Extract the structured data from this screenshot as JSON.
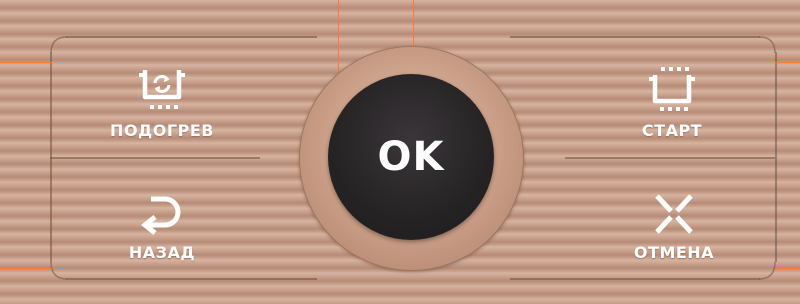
{
  "panel": {
    "colors": {
      "base": "#c79f8a",
      "stripe_light": "#d6b4a1",
      "stripe_dark": "#b58c77",
      "ring": "#c99d85",
      "ok_button": "#262325",
      "callout_line": "#ff7a2a",
      "label_text": "#ffffff"
    },
    "buttons": {
      "reheat": {
        "label": "ПОДОГРЕВ",
        "icon": "pot-refresh-icon"
      },
      "start": {
        "label": "СТАРТ",
        "icon": "pot-steam-icon"
      },
      "back": {
        "label": "НАЗАД",
        "icon": "back-arrow-icon"
      },
      "cancel": {
        "label": "ОТМЕНА",
        "icon": "close-icon"
      },
      "ok": {
        "label": "OK"
      }
    }
  }
}
